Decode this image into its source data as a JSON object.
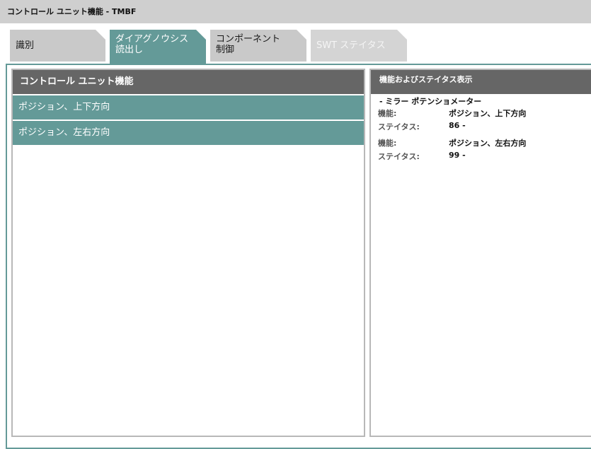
{
  "window": {
    "title": "コントロール ユニット機能 - TMBF"
  },
  "tabs": [
    {
      "label": "識別",
      "state": "normal"
    },
    {
      "label": "ダイアグノウシス\n読出し",
      "state": "active"
    },
    {
      "label": "コンポーネント\n制御",
      "state": "normal"
    },
    {
      "label": "SWT ステイタス",
      "state": "disabled"
    }
  ],
  "left_panel": {
    "header": "コントロール ユニット機能",
    "items": [
      {
        "label": "ポジション、上下方向"
      },
      {
        "label": "ポジション、左右方向"
      }
    ]
  },
  "right_panel": {
    "header": "機能およびステイタス表示",
    "section_title": "- ミラー ポテンショメーター",
    "rows": [
      {
        "key": "機能:",
        "value": "ポジション、上下方向"
      },
      {
        "key": "ステイタス:",
        "value": "86 -"
      },
      {
        "key": "機能:",
        "value": "ポジション、左右方向"
      },
      {
        "key": "ステイタス:",
        "value": "99 -"
      }
    ]
  },
  "colors": {
    "accent": "#649a98",
    "header": "#666666",
    "tab_inactive": "#c9c9c9",
    "titlebar": "#cfcfcf"
  }
}
